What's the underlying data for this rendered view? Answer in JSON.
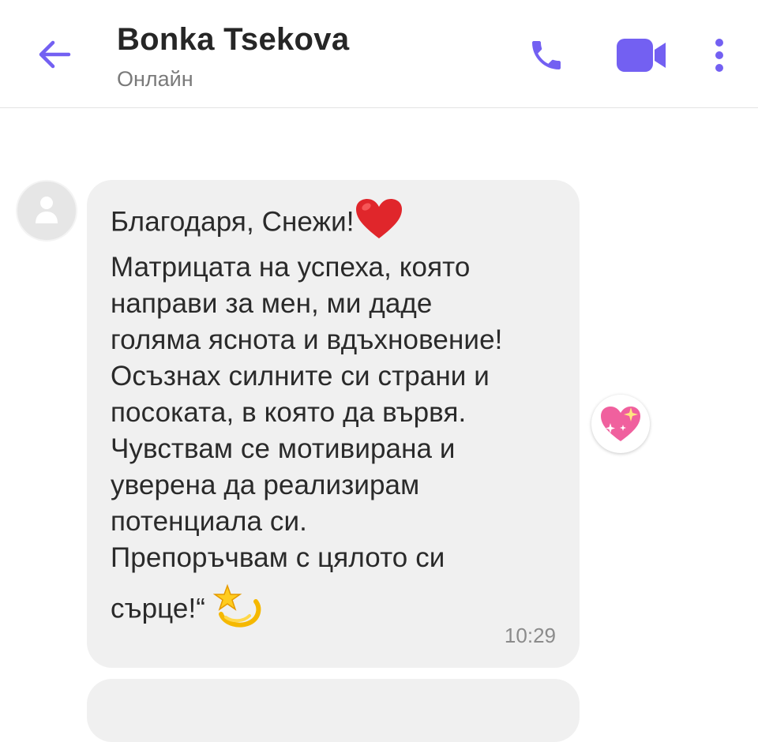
{
  "header": {
    "contact_name": "Bonka Tsekova",
    "status": "Онлайн",
    "accent_color": "#7360f2"
  },
  "message": {
    "lines": [
      "Благодаря, Снежи!",
      "Матрицата на успеха, която",
      "направи за мен, ми даде",
      "голяма яснота и вдъхновение!",
      "Осъзнах силните си страни и",
      "посоката, в която да вървя.",
      "Чувствам се мотивирана и",
      "уверена да реализирам",
      "потенциала си.",
      "Препоръчвам с цялото си",
      "сърце!“"
    ],
    "time": "10:29",
    "inline_emojis": [
      "red-heart",
      "dizzy-star"
    ],
    "reaction": "sparkling-heart"
  },
  "icons": {
    "back": "arrow-left-icon",
    "call": "phone-icon",
    "video": "video-camera-icon",
    "more": "more-vertical-icon",
    "avatar": "default-avatar-icon"
  }
}
